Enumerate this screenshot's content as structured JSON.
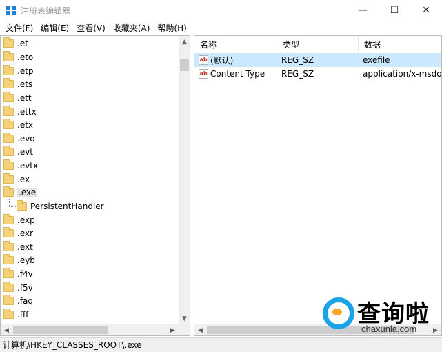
{
  "window": {
    "title": "注册表编辑器",
    "controls": {
      "minimize": "—",
      "maximize": "☐",
      "close": "✕"
    }
  },
  "menu": [
    "文件(F)",
    "编辑(E)",
    "查看(V)",
    "收藏夹(A)",
    "帮助(H)"
  ],
  "tree": {
    "items_before": [
      ".et",
      ".eto",
      ".etp",
      ".ets",
      ".ett",
      ".ettx",
      ".etx",
      ".evo",
      ".evt",
      ".evtx",
      ".ex_"
    ],
    "selected": ".exe",
    "child": "PersistentHandler",
    "items_after": [
      ".exp",
      ".exr",
      ".ext",
      ".eyb",
      ".f4v",
      ".f5v",
      ".faq",
      ".fff"
    ]
  },
  "values": {
    "columns": [
      "名称",
      "类型",
      "数据"
    ],
    "rows": [
      {
        "name": "(默认)",
        "type": "REG_SZ",
        "data": "exefile"
      },
      {
        "name": "Content Type",
        "type": "REG_SZ",
        "data": "application/x-msdownload"
      }
    ]
  },
  "status": "计算机\\HKEY_CLASSES_ROOT\\.exe",
  "watermark": {
    "title": "查询啦",
    "site": "chaxunla.com"
  },
  "colors": {
    "selection": "#cce8ff",
    "folder": "#f5d27a",
    "watermark_blue": "#1aa3e8",
    "watermark_orange": "#f5a623"
  }
}
